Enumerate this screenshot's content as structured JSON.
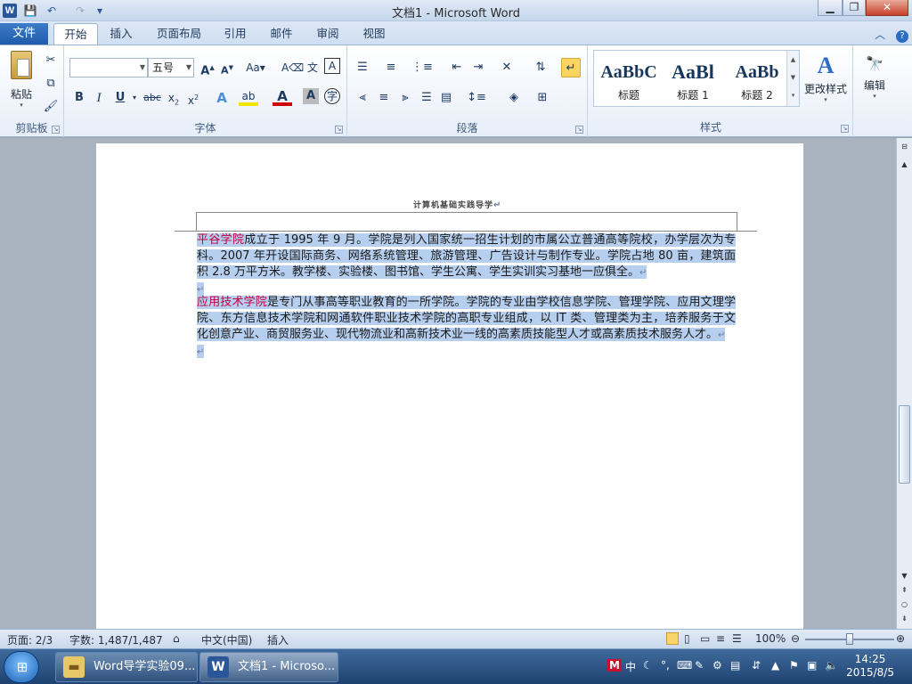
{
  "window": {
    "title": "文档1 - Microsoft Word",
    "minimize": "▁",
    "restore": "❐",
    "close": "✕"
  },
  "qat": {
    "save": "💾",
    "undo": "↶",
    "redo": "↷",
    "customize": "▾"
  },
  "ribbon_tabs": {
    "file": "文件",
    "tabs": [
      "开始",
      "插入",
      "页面布局",
      "引用",
      "邮件",
      "审阅",
      "视图"
    ],
    "active": "开始"
  },
  "clipboard": {
    "paste": "粘贴",
    "label": "剪贴板"
  },
  "font": {
    "name_value": "",
    "size_value": "五号",
    "label": "字体"
  },
  "paragraph": {
    "label": "段落"
  },
  "styles": {
    "label": "样式",
    "tiles": [
      {
        "sample": "AaBbC",
        "name": "标题"
      },
      {
        "sample": "AaBl",
        "name": "标题 1"
      },
      {
        "sample": "AaBb",
        "name": "标题 2"
      }
    ],
    "change_styles": "更改样式"
  },
  "editing": {
    "label": "编辑"
  },
  "document": {
    "header": "计算机基础实践导学",
    "p1_red": "平谷学院",
    "p1_rest": "成立于 1995 年 9 月。学院是列入国家统一招生计划的市属公立普通高等院校，办学层次为专科。2007 年开设国际商务、网络系统管理、旅游管理、广告设计与制作专业。学院占地 80 亩，建筑面积 2.8 万平方米。教学楼、实验楼、图书馆、学生公寓、学生实训实习基地一应俱全。",
    "p2_red": "应用技术学院",
    "p2_rest": "是专门从事高等职业教育的一所学院。学院的专业由学校信息学院、管理学院、应用文理学院、东方信息技术学院和网通软件职业技术学院的高职专业组成，以 IT 类、管理类为主，培养服务于文化创意产业、商贸服务业、现代物流业和高新技术业一线的高素质技能型人才或高素质技术服务人才。",
    "pilcrow": "↵"
  },
  "status": {
    "page": "页面: 2/3",
    "words": "字数: 1,487/1,487",
    "language": "中文(中国)",
    "mode": "插入",
    "zoom": "100%"
  },
  "taskbar": {
    "items": [
      "Word导学实验09...",
      "文档1 - Microso..."
    ],
    "ime": "中",
    "time": "14:25",
    "date": "2015/8/5"
  }
}
